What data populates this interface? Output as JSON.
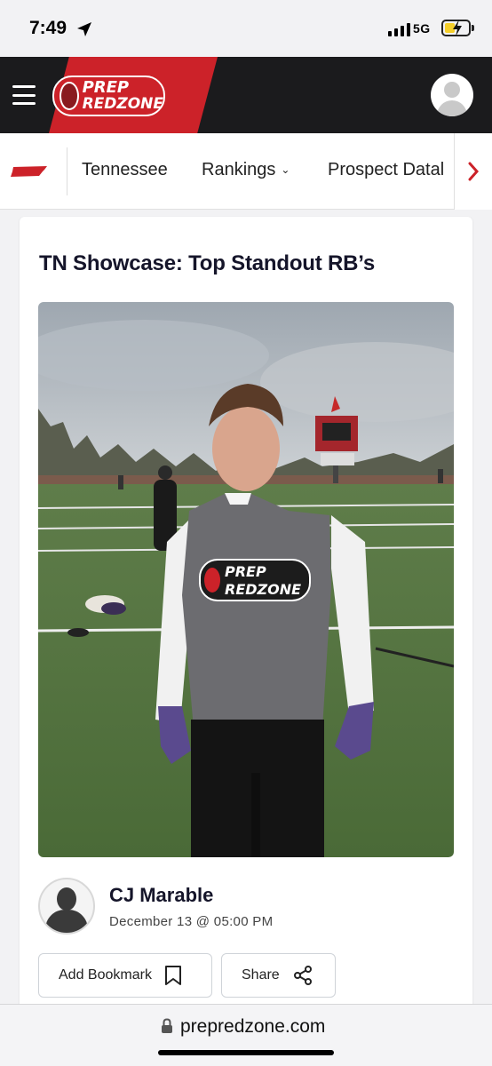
{
  "status_bar": {
    "time": "7:49",
    "network": "5G",
    "location_icon": "location-arrow-icon",
    "battery_icon": "battery-charging-icon"
  },
  "header": {
    "menu_icon": "hamburger-menu-icon",
    "logo_line1": "PREP",
    "logo_line2": "REDZONE",
    "profile_icon": "user-avatar-icon",
    "brand_red": "#cc2229",
    "header_bg": "#1b1b1d"
  },
  "nav": {
    "state_icon": "tennessee-state-icon",
    "items": [
      {
        "label": "Tennessee"
      },
      {
        "label": "Rankings"
      },
      {
        "label": "Prospect Datal"
      }
    ],
    "dropdown_icon": "chevron-down-icon",
    "next_icon": "chevron-right-icon"
  },
  "article": {
    "title": "TN Showcase: Top Standout RB’s",
    "photo_shirt_line1": "PREP",
    "photo_shirt_line2": "REDZONE",
    "author": "CJ Marable",
    "date": "December 13 @ 05:00 PM",
    "bookmark_label": "Add Bookmark",
    "bookmark_icon": "bookmark-icon",
    "share_label": "Share",
    "share_icon": "share-icon"
  },
  "browser": {
    "url": "prepredzone.com",
    "lock_icon": "lock-icon"
  }
}
